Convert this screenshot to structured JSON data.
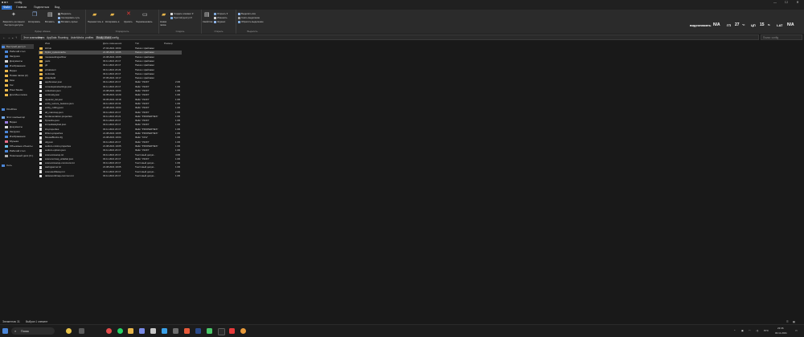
{
  "window": {
    "title": "config",
    "controls": [
      "—",
      "☐",
      "✕"
    ]
  },
  "ribbon_tabs": [
    "Файл",
    "Главная",
    "Поделиться",
    "Вид"
  ],
  "ribbon": {
    "clipboard": {
      "pin": "Закрепить на панели быстрого доступа",
      "copy": "Копировать",
      "paste": "Вставить",
      "cut": "Вырезать",
      "copy_path": "Скопировать путь",
      "paste_shortcut": "Вставить ярлык",
      "group": "Буфер обмена"
    },
    "organize": {
      "move": "Переместить в",
      "copy_to": "Копировать в",
      "delete": "Удалить",
      "rename": "Переименовать",
      "group": "Упорядочить"
    },
    "new": {
      "new_folder": "Новая папка",
      "new_item": "Создать элемент",
      "easy_access": "Простой доступ",
      "group": "Создать"
    },
    "open": {
      "properties": "Свойства",
      "open": "Открыть",
      "edit": "Изменить",
      "history": "Журнал",
      "group": "Открыть"
    },
    "select": {
      "select_all": "Выделить все",
      "select_none": "Снять выделение",
      "invert": "Обратить выделение",
      "group": "Выделить"
    }
  },
  "system": {
    "gpu_label": "видеопамять",
    "gpu_value": "N/A",
    "gpu_temp_label": "ГП",
    "gpu_temp": "27",
    "cpu_label": "ЦП",
    "cpu_load": "15",
    "lat_label": "LAT",
    "lat_value": "N/A"
  },
  "address": {
    "crumbs": [
      "Этот компьютер",
      "Users",
      "AppData",
      "Roaming",
      "AstroWorks",
      "profiles",
      "Really World",
      "config"
    ],
    "search_placeholder": "Поиск: config"
  },
  "nav": [
    "Быстрый доступ",
    "Рабочий стол",
    "Загрузки",
    "Документы",
    "Изображения",
    "Видео",
    "Новая папка (2)",
    "Мои",
    "Vor",
    "Pixel Studio",
    "Для Мен папка",
    "OneDrive",
    "Этот компьютер",
    "Видео",
    "Документы",
    "Загрузки",
    "Изображения",
    "Музыка",
    "Объемные объекты",
    "Рабочий стол",
    "Локальный диск (C:)",
    "Сеть"
  ],
  "columns": {
    "name": "Имя",
    "date": "Дата изменения",
    "type": "Тип",
    "size": "Размер"
  },
  "files": [
    {
      "name": "lobrus",
      "date": "27.04.2021 19:04",
      "type": "Папка с файлами",
      "size": "",
      "kind": "folder"
    },
    {
      "name": "Mylist_systemcache",
      "date": "21.08.2021 19:05",
      "type": "Папка с файлами",
      "size": "",
      "kind": "folder"
    },
    {
      "name": "mousesettingsofficer",
      "date": "21.08.2021 19:05",
      "type": "Папка с файлами",
      "size": "",
      "kind": "folder"
    },
    {
      "name": "pads",
      "date": "03.11.2021 23:17",
      "type": "Папка с файлами",
      "size": "",
      "kind": "folder"
    },
    {
      "name": "git",
      "date": "03.11.2021 23:17",
      "type": "Папка с файлами",
      "size": "",
      "kind": "folder"
    },
    {
      "name": "privateseri",
      "date": "03.11.2021 23:23",
      "type": "Папка с файлами",
      "size": "",
      "kind": "folder"
    },
    {
      "name": "textlocale",
      "date": "03.11.2021 23:17",
      "type": "Папка с файлами",
      "size": "",
      "kind": "folder"
    },
    {
      "name": "videobuild",
      "date": "07.05.2021 19:17",
      "type": "Папка с файлами",
      "size": "",
      "kind": "folder"
    },
    {
      "name": "appbrowser.json",
      "date": "03.11.2021 23:17",
      "type": "Файл \"JSON\"",
      "size": "2 КБ",
      "kind": "file"
    },
    {
      "name": "consolepanelsettings.json",
      "date": "03.11.2021 23:17",
      "type": "Файл \"JSON\"",
      "size": "1 КБ",
      "kind": "file"
    },
    {
      "name": "collections.json",
      "date": "21.08.2021 19:04",
      "type": "Файл \"JSON\"",
      "size": "1 КБ",
      "kind": "file"
    },
    {
      "name": "continuity.json",
      "date": "02.05.2021 12:29",
      "type": "Файл \"JSON\"",
      "size": "1 КБ",
      "kind": "file"
    },
    {
      "name": "dynamic_list.json",
      "date": "03.05.2021 19:18",
      "type": "Файл \"JSON\"",
      "size": "1 КБ",
      "kind": "file"
    },
    {
      "name": "entity_texture_features.json",
      "date": "03.11.2021 23:19",
      "type": "Файл \"JSON\"",
      "size": "1 КБ",
      "kind": "file"
    },
    {
      "name": "entity_culling.json",
      "date": "21.08.2021 19:04",
      "type": "Файл \"JSON\"",
      "size": "1 КБ",
      "kind": "file"
    },
    {
      "name": "all_mainmap.json",
      "date": "03.11.2021 23:17",
      "type": "Файл \"JSON\"",
      "size": "1 КБ",
      "kind": "file"
    },
    {
      "name": "fendamentation.properties",
      "date": "03.11.2021 23:21",
      "type": "Файл \"PROPERTIES\"",
      "size": "1 КБ",
      "kind": "file"
    },
    {
      "name": "flyroutine.json",
      "date": "03.11.2021 23:17",
      "type": "Файл \"JSON\"",
      "size": "1 КБ",
      "kind": "file"
    },
    {
      "name": "immediatelyfast.json",
      "date": "03.11.2021 23:17",
      "type": "Файл \"JSON\"",
      "size": "1 КБ",
      "kind": "file"
    },
    {
      "name": "iris.properties",
      "date": "03.11.2021 23:17",
      "type": "Файл \"PROPERTIES\"",
      "size": "1 КБ",
      "kind": "file"
    },
    {
      "name": "lithium.properties",
      "date": "21.08.2021 19:05",
      "type": "Файл \"PROPERTIES\"",
      "size": "1 КБ",
      "kind": "file"
    },
    {
      "name": "MouseBlocks.cfg",
      "date": "21.08.2021 19:04",
      "type": "Файл \"CFG\"",
      "size": "1 КБ",
      "kind": "file"
    },
    {
      "name": "obj.json",
      "date": "03.11.2021 23:17",
      "type": "Файл \"JSON\"",
      "size": "1 КБ",
      "kind": "file"
    },
    {
      "name": "sodium-mixins.properties",
      "date": "21.08.2021 19:05",
      "type": "Файл \"PROPERTIES\"",
      "size": "1 КБ",
      "kind": "file"
    },
    {
      "name": "sodium-options.json",
      "date": "03.11.2021 23:17",
      "type": "Файл \"JSON\"",
      "size": "1 КБ",
      "kind": "file"
    },
    {
      "name": "scenemixsetup.txt",
      "date": "03.11.2021 23:17",
      "type": "Текстовый докум...",
      "size": "4 КБ",
      "kind": "file"
    },
    {
      "name": "scenenormap_widebar.json",
      "date": "03.11.2021 23:17",
      "type": "Файл \"JSON\"",
      "size": "1 КБ",
      "kind": "file"
    },
    {
      "name": "scenemixsetup-commons.txt",
      "date": "03.11.2021 23:17",
      "type": "Текстовый докум...",
      "size": "1 КБ",
      "kind": "file"
    },
    {
      "name": "savingserver.txt",
      "date": "21.08.2021 19:05",
      "type": "Текстовый докум...",
      "size": "1 КБ",
      "kind": "file"
    },
    {
      "name": "scenetextfilesup.txt",
      "date": "03.11.2021 23:17",
      "type": "Текстовый докум...",
      "size": "2 КБ",
      "kind": "file"
    },
    {
      "name": "tabletworldmap-common.txt",
      "date": "03.11.2021 23:17",
      "type": "Текстовый докум...",
      "size": "1 КБ",
      "kind": "file"
    }
  ],
  "selected_row": 1,
  "status": {
    "count": "Элементов: 31",
    "selected": "Выбран 1 элемент"
  },
  "taskbar": {
    "search_label": "Поиск",
    "time": "23:36",
    "date": "03.11.2021",
    "lang": "РУС"
  },
  "colors": {
    "accent": "#2b6bc4",
    "folder": "#e8b64a",
    "selection": "#4a4a4a"
  }
}
